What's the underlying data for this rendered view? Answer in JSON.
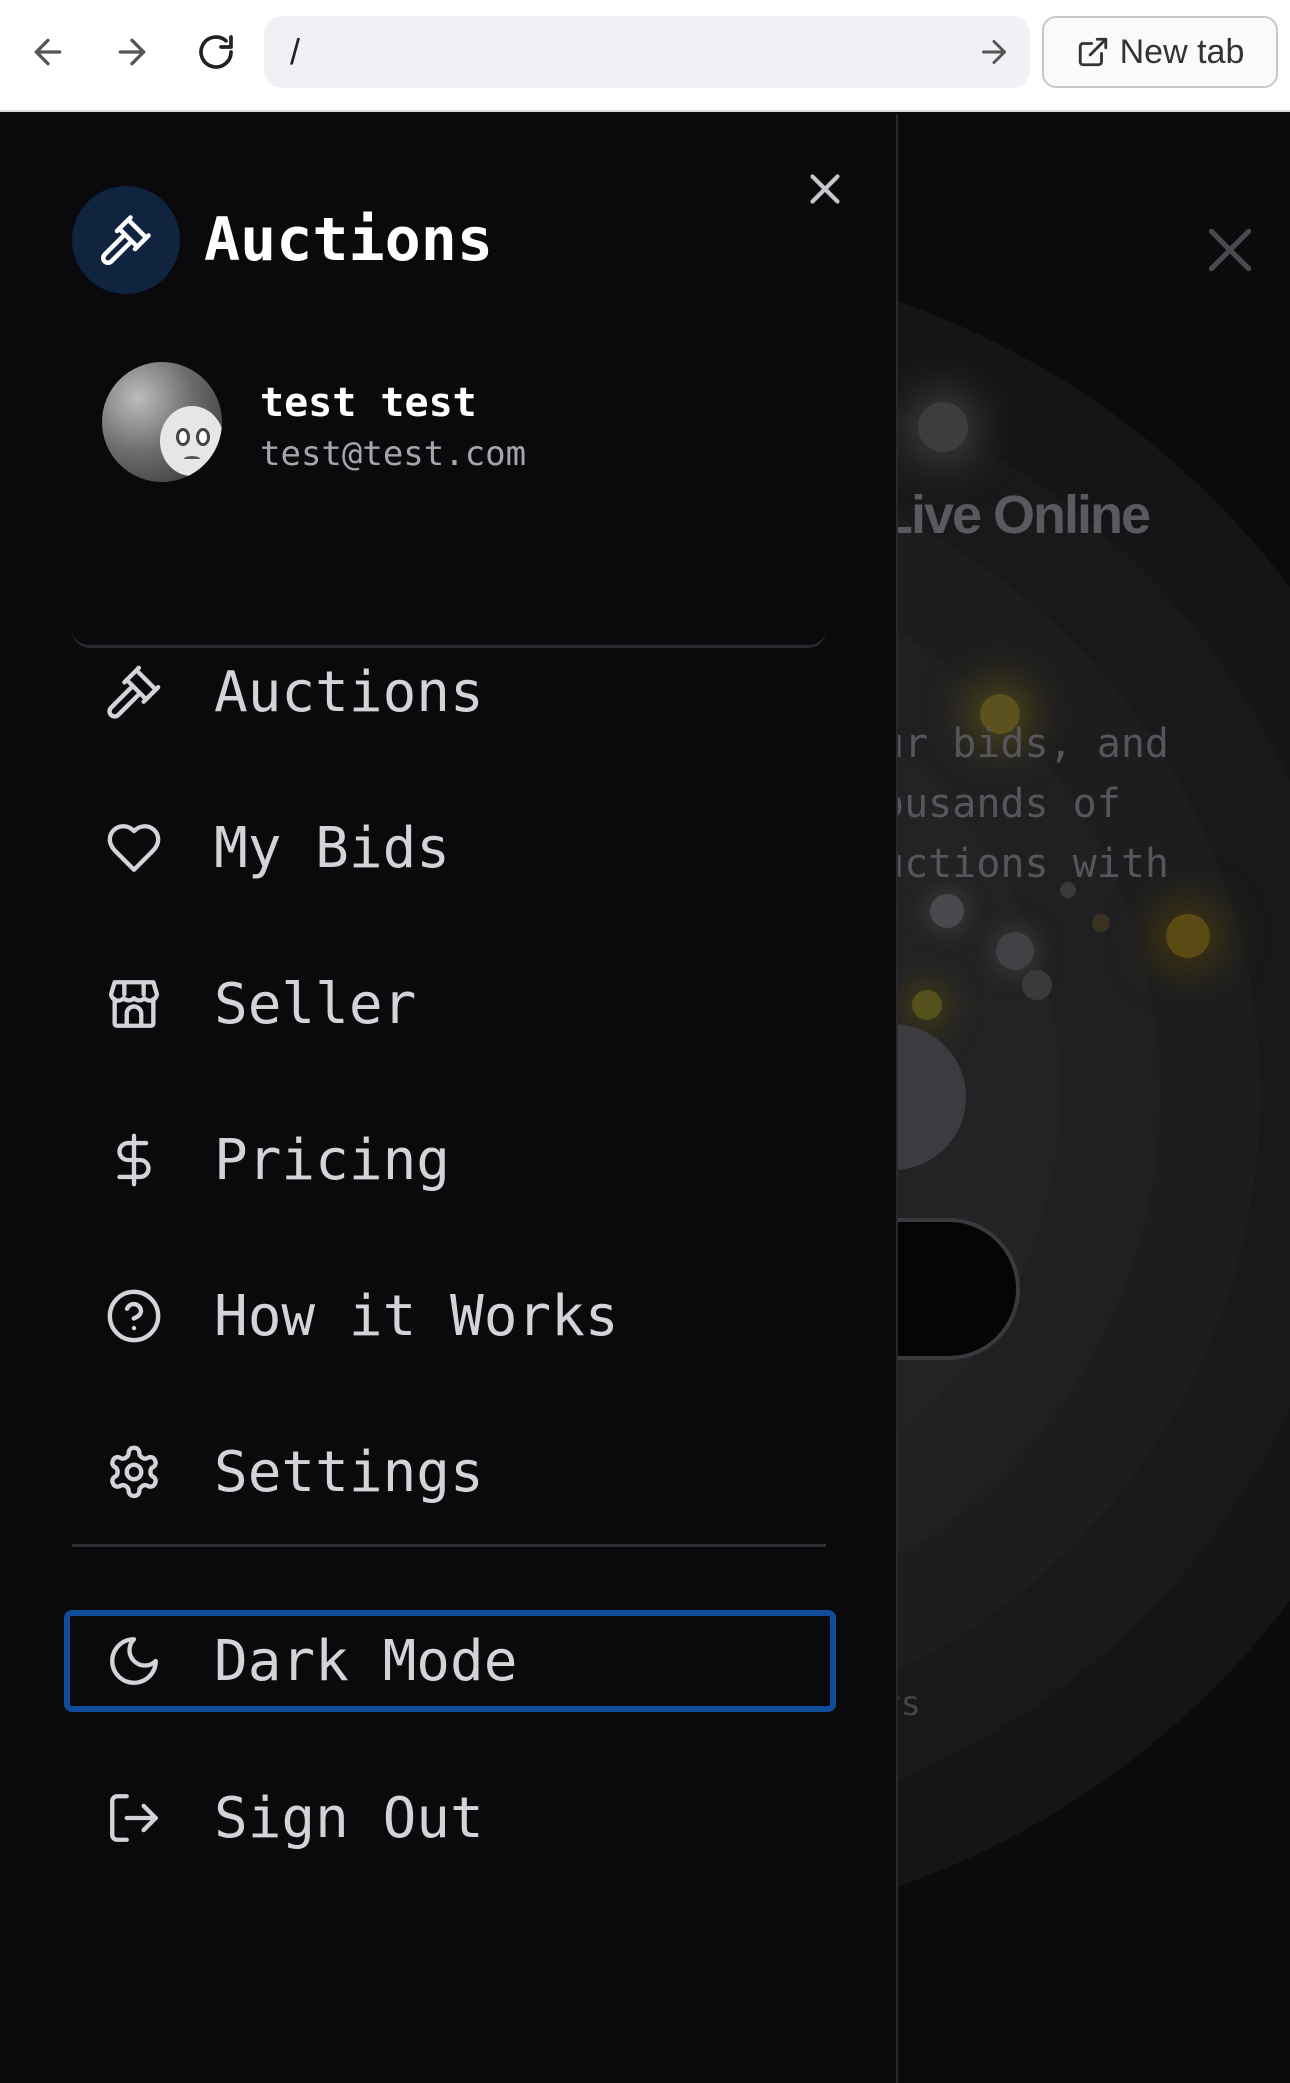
{
  "browser": {
    "url": "/",
    "new_tab_label": "New tab",
    "icons": [
      "back-arrow-icon",
      "forward-arrow-icon",
      "reload-icon",
      "go-arrow-icon",
      "external-link-icon"
    ]
  },
  "background": {
    "headline": "Live Online",
    "paragraph": "ur bids, and\nousands of\nuctions with",
    "footer_fragment": "rs"
  },
  "drawer": {
    "brand": {
      "title": "Auctions",
      "icon": "gavel-icon",
      "badge_color": "#102440"
    },
    "user": {
      "name": "test test",
      "email": "test@test.com"
    },
    "menu": [
      {
        "label": "Auctions",
        "icon": "gavel-icon"
      },
      {
        "label": "My Bids",
        "icon": "heart-icon"
      },
      {
        "label": "Seller",
        "icon": "store-icon"
      },
      {
        "label": "Pricing",
        "icon": "dollar-icon"
      },
      {
        "label": "How it Works",
        "icon": "help-circle-icon"
      },
      {
        "label": "Settings",
        "icon": "gear-icon"
      }
    ],
    "secondary": [
      {
        "label": "Dark Mode",
        "icon": "moon-icon",
        "focused": true
      },
      {
        "label": "Sign Out",
        "icon": "logout-icon"
      }
    ],
    "colors": {
      "background": "#0a0a0c",
      "text": "#d4d4d8",
      "focus_ring": "#0f4c9c"
    }
  }
}
